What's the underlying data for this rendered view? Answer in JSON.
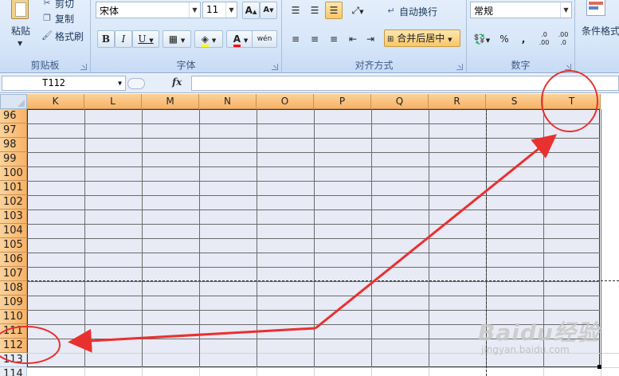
{
  "ribbon": {
    "clipboard": {
      "label": "剪贴板",
      "paste": "粘贴",
      "cut": "剪切",
      "copy": "复制",
      "format_painter": "格式刷"
    },
    "font": {
      "label": "字体",
      "font_name": "宋体",
      "font_size": "11",
      "grow": "A",
      "shrink": "A",
      "bold": "B",
      "italic": "I",
      "underline": "U",
      "font_color": "A",
      "phonetic": "wén"
    },
    "alignment": {
      "label": "对齐方式",
      "wrap_text": "自动换行",
      "merge_center": "合并后居中"
    },
    "number": {
      "label": "数字",
      "format": "常规",
      "percent": "%",
      "comma": ",",
      "inc_decimal": ".0 .00",
      "dec_decimal": ".00 .0"
    },
    "styles": {
      "conditional_format": "条件格式"
    }
  },
  "formula_bar": {
    "name_box": "T112",
    "fx": "fx"
  },
  "grid": {
    "columns": [
      "K",
      "L",
      "M",
      "N",
      "O",
      "P",
      "Q",
      "R",
      "S",
      "T"
    ],
    "rows": [
      "96",
      "97",
      "98",
      "99",
      "100",
      "101",
      "102",
      "103",
      "104",
      "105",
      "106",
      "107",
      "108",
      "109",
      "110",
      "111",
      "112",
      "113",
      "114"
    ]
  },
  "watermark": {
    "brand": "Baidu经验",
    "url": "jingyan.baidu.com"
  },
  "colors": {
    "header_orange": "#f8b265",
    "selection_fill": "#e8eaf5",
    "annotation_red": "#e8312f"
  }
}
